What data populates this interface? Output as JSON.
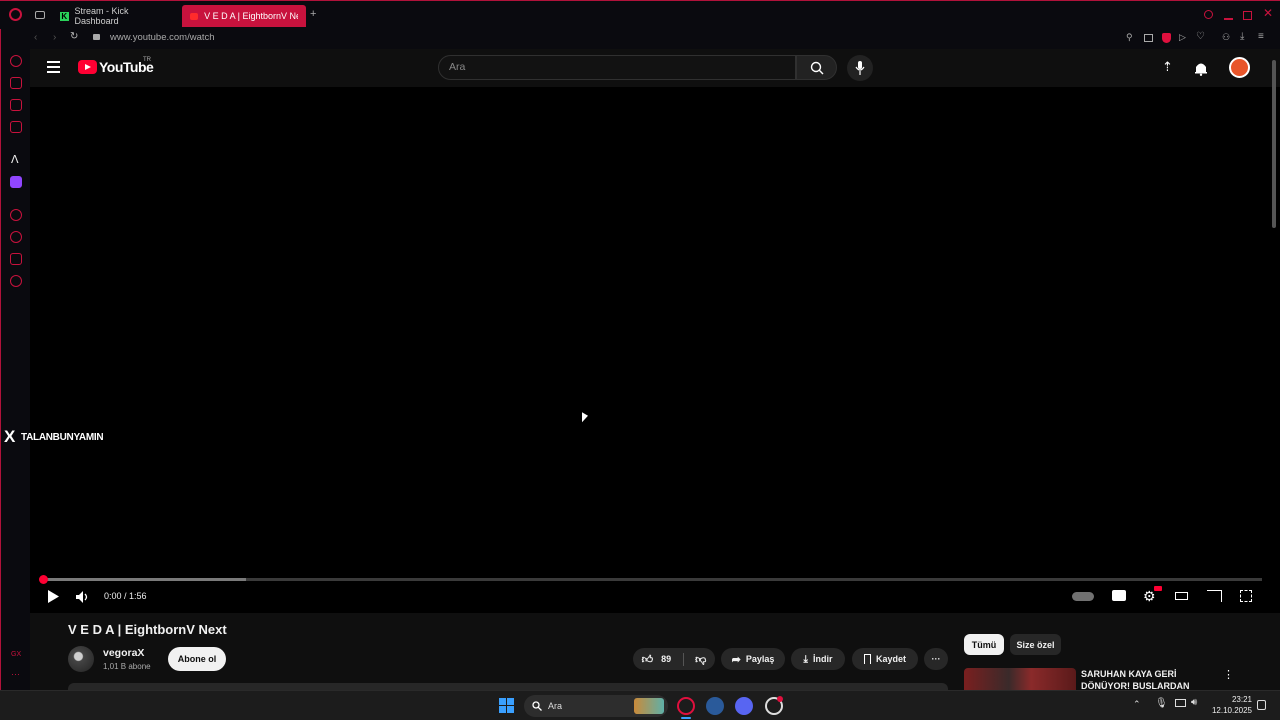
{
  "browser": {
    "tabs": [
      {
        "label": "Stream - Kick Dashboard",
        "active": false
      },
      {
        "label": "V E D A | EightbornV Next",
        "active": true
      }
    ],
    "new_tab_label": "+",
    "url": "www.youtube.com/watch"
  },
  "youtube": {
    "logo_text": "YouTube",
    "region": "TR",
    "search_placeholder": "Ara"
  },
  "player": {
    "time": "0:00 / 1:56",
    "overlay_text": "TALANBUNYAMIN",
    "overlay_logo": "X"
  },
  "video": {
    "title": "V E D A | EightbornV Next",
    "channel": "vegoraX",
    "subscribers": "1,01 B abone",
    "subscribe_label": "Abone ol",
    "likes": "89",
    "share_label": "Paylaş",
    "download_label": "İndir",
    "save_label": "Kaydet"
  },
  "recommendations": {
    "chips": [
      "Tümü",
      "Size özel"
    ],
    "first_title": "SARUHAN KAYA GERİ DÖNÜYOR! BUSLARDAN"
  },
  "sidebar_bottom": "GX",
  "taskbar": {
    "search_label": "Ara",
    "time": "23:21",
    "date": "12.10.2025"
  },
  "colors": {
    "opera_accent": "#c8123d",
    "youtube_red": "#ff0033",
    "windows_blue": "#3aa0ff"
  }
}
